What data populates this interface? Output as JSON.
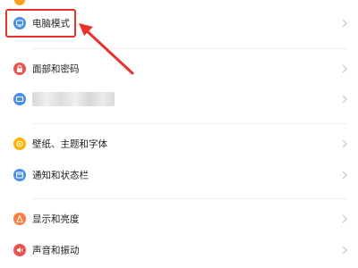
{
  "colors": {
    "blue_icon": "#4a90e2",
    "red_icon": "#ef5350",
    "yellow_icon": "#ffb300",
    "orange_icon": "#ff7a3d",
    "annotation_red": "#e8312b",
    "top_dot": "#ff9f1c"
  },
  "settings": {
    "items": [
      {
        "label": "电脑模式",
        "icon": "monitor-icon",
        "color": "#4a90e2"
      },
      {
        "label": "面部和密码",
        "icon": "lock-icon",
        "color": "#ef5350"
      },
      {
        "label": "",
        "icon": "display-icon",
        "color": "#4a90e2",
        "blurred": true
      },
      {
        "label": "壁纸、主题和字体",
        "icon": "palette-icon",
        "color": "#ffb300"
      },
      {
        "label": "通知和状态栏",
        "icon": "notification-icon",
        "color": "#4a90e2"
      },
      {
        "label": "显示和亮度",
        "icon": "brightness-icon",
        "color": "#ff7a3d"
      },
      {
        "label": "声音和振动",
        "icon": "sound-icon",
        "color": "#ef5350"
      }
    ]
  }
}
